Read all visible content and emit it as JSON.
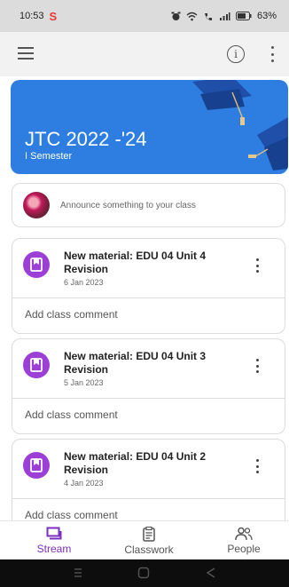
{
  "status_bar": {
    "time": "10:53",
    "app_letter": "S",
    "battery": "63%"
  },
  "class": {
    "title": "JTC 2022 -'24",
    "section": "I Semester"
  },
  "announce": {
    "placeholder": "Announce something to your class"
  },
  "posts": [
    {
      "title": "New material: EDU 04 Unit 4 Revision",
      "date": "6 Jan 2023",
      "comment": "Add class comment"
    },
    {
      "title": "New material: EDU 04 Unit 3 Revision",
      "date": "5 Jan 2023",
      "comment": "Add class comment"
    },
    {
      "title": "New material: EDU 04 Unit 2 Revision",
      "date": "4 Jan 2023",
      "comment": "Add class comment"
    }
  ],
  "bottom_nav": [
    {
      "label": "Stream",
      "icon": "stream-icon",
      "active": true
    },
    {
      "label": "Classwork",
      "icon": "classwork-icon",
      "active": false
    },
    {
      "label": "People",
      "icon": "people-icon",
      "active": false
    }
  ],
  "colors": {
    "banner": "#2d7ee0",
    "accent": "#7b2fc0",
    "material_icon": "#9c3fd6"
  }
}
